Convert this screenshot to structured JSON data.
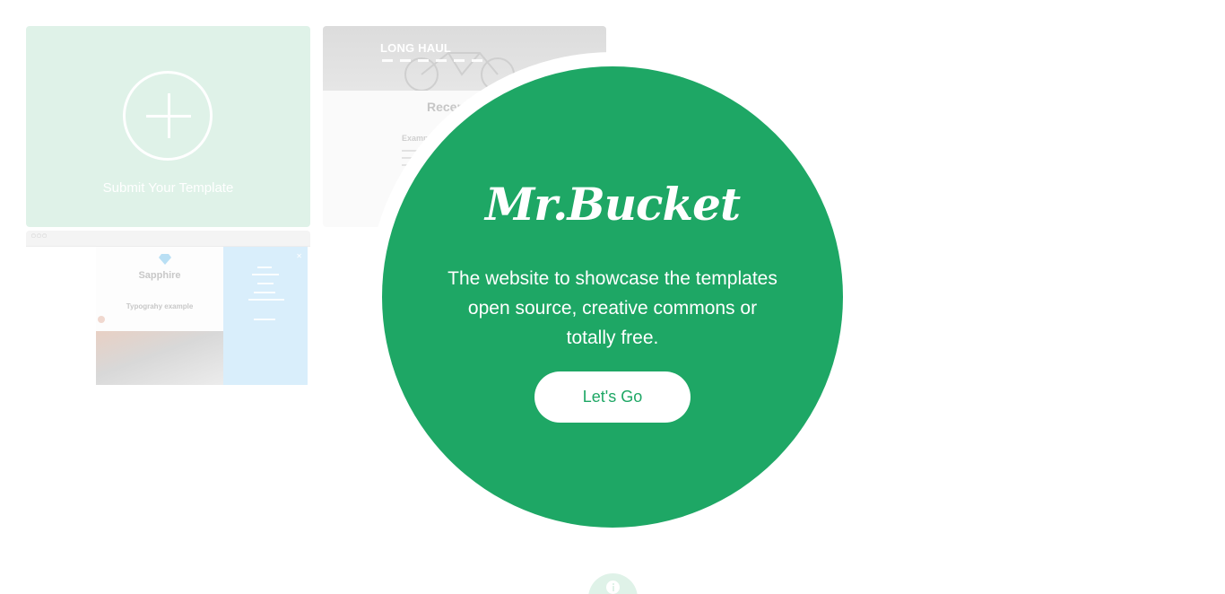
{
  "brand": {
    "name": "Mr.Bucket"
  },
  "hero": {
    "tagline": "The website to showcase the templates open source, creative commons or totally free.",
    "cta_label": "Let's Go"
  },
  "submit_card": {
    "label": "Submit Your Template"
  },
  "templates": [
    {
      "title": "LONG HAUL",
      "heading": "Recen",
      "subheading": "Exampl"
    },
    {
      "title": "Sapphire",
      "heading": "Typograhy example"
    }
  ],
  "colors": {
    "accent": "#1ea765",
    "accent_light": "#dff2e8",
    "sidebar_light": "#d9eefb"
  },
  "icons": {
    "submit": "plus-circle-icon",
    "info": "info-icon"
  }
}
